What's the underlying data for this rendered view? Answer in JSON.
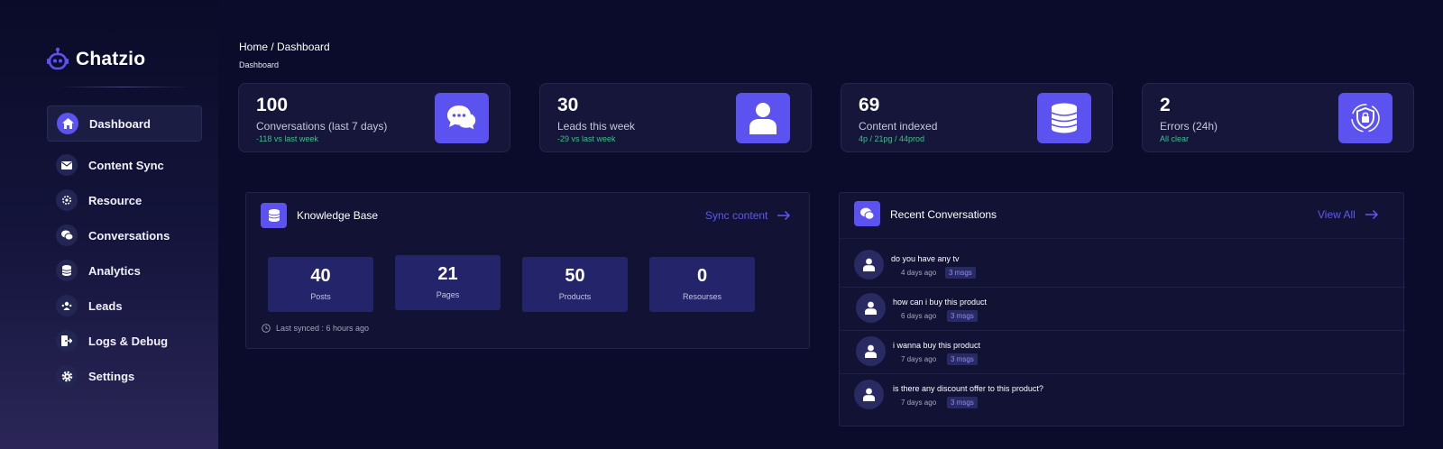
{
  "app": {
    "name": "Chatzio",
    "accent_color": "#5b52f0",
    "logo_icon": "robot-icon"
  },
  "sidebar": {
    "items": [
      {
        "label": "Dashboard",
        "icon": "home-icon",
        "active": true
      },
      {
        "label": "Content Sync",
        "icon": "envelope-icon",
        "active": false
      },
      {
        "label": "Resource",
        "icon": "gear-small-icon",
        "active": false
      },
      {
        "label": "Conversations",
        "icon": "chat-bubbles-icon",
        "active": false
      },
      {
        "label": "Analytics",
        "icon": "database-icon",
        "active": false
      },
      {
        "label": "Leads",
        "icon": "user-group-icon",
        "active": false
      },
      {
        "label": "Logs & Debug",
        "icon": "logout-icon",
        "active": false
      },
      {
        "label": "Settings",
        "icon": "gear-icon",
        "active": false
      }
    ]
  },
  "header": {
    "breadcrumb": "Home / Dashboard",
    "subtitle": "Dashboard"
  },
  "stats": [
    {
      "value": "100",
      "label": "Conversations (last 7 days)",
      "sub": "-118 vs last week",
      "icon": "chat-bubbles-icon"
    },
    {
      "value": "30",
      "label": "Leads this week",
      "sub": "-29 vs last week",
      "icon": "user-icon"
    },
    {
      "value": "69",
      "label": "Content indexed",
      "sub": "4p / 21pg / 44prod",
      "icon": "database-icon"
    },
    {
      "value": "2",
      "label": "Errors (24h)",
      "sub": "All clear",
      "icon": "shield-lock-icon"
    }
  ],
  "knowledge_base": {
    "title": "Knowledge Base",
    "link_label": "Sync content",
    "items": [
      {
        "value": "40",
        "label": "Posts"
      },
      {
        "value": "21",
        "label": "Pages"
      },
      {
        "value": "50",
        "label": "Products"
      },
      {
        "value": "0",
        "label": "Resourses"
      }
    ],
    "last_synced": "Last synced : 6 hours ago"
  },
  "recent_conversations": {
    "title": "Recent Conversations",
    "link_label": "View All",
    "items": [
      {
        "message": "do you have any tv",
        "time": "4 days ago",
        "badge": "3 msgs"
      },
      {
        "message": "how can i buy this product",
        "time": "6 days ago",
        "badge": "3 msgs"
      },
      {
        "message": "i wanna buy this product",
        "time": "7 days ago",
        "badge": "3 msgs"
      },
      {
        "message": "is there any discount offer to this product?",
        "time": "7 days ago",
        "badge": "3 msgs"
      }
    ]
  }
}
